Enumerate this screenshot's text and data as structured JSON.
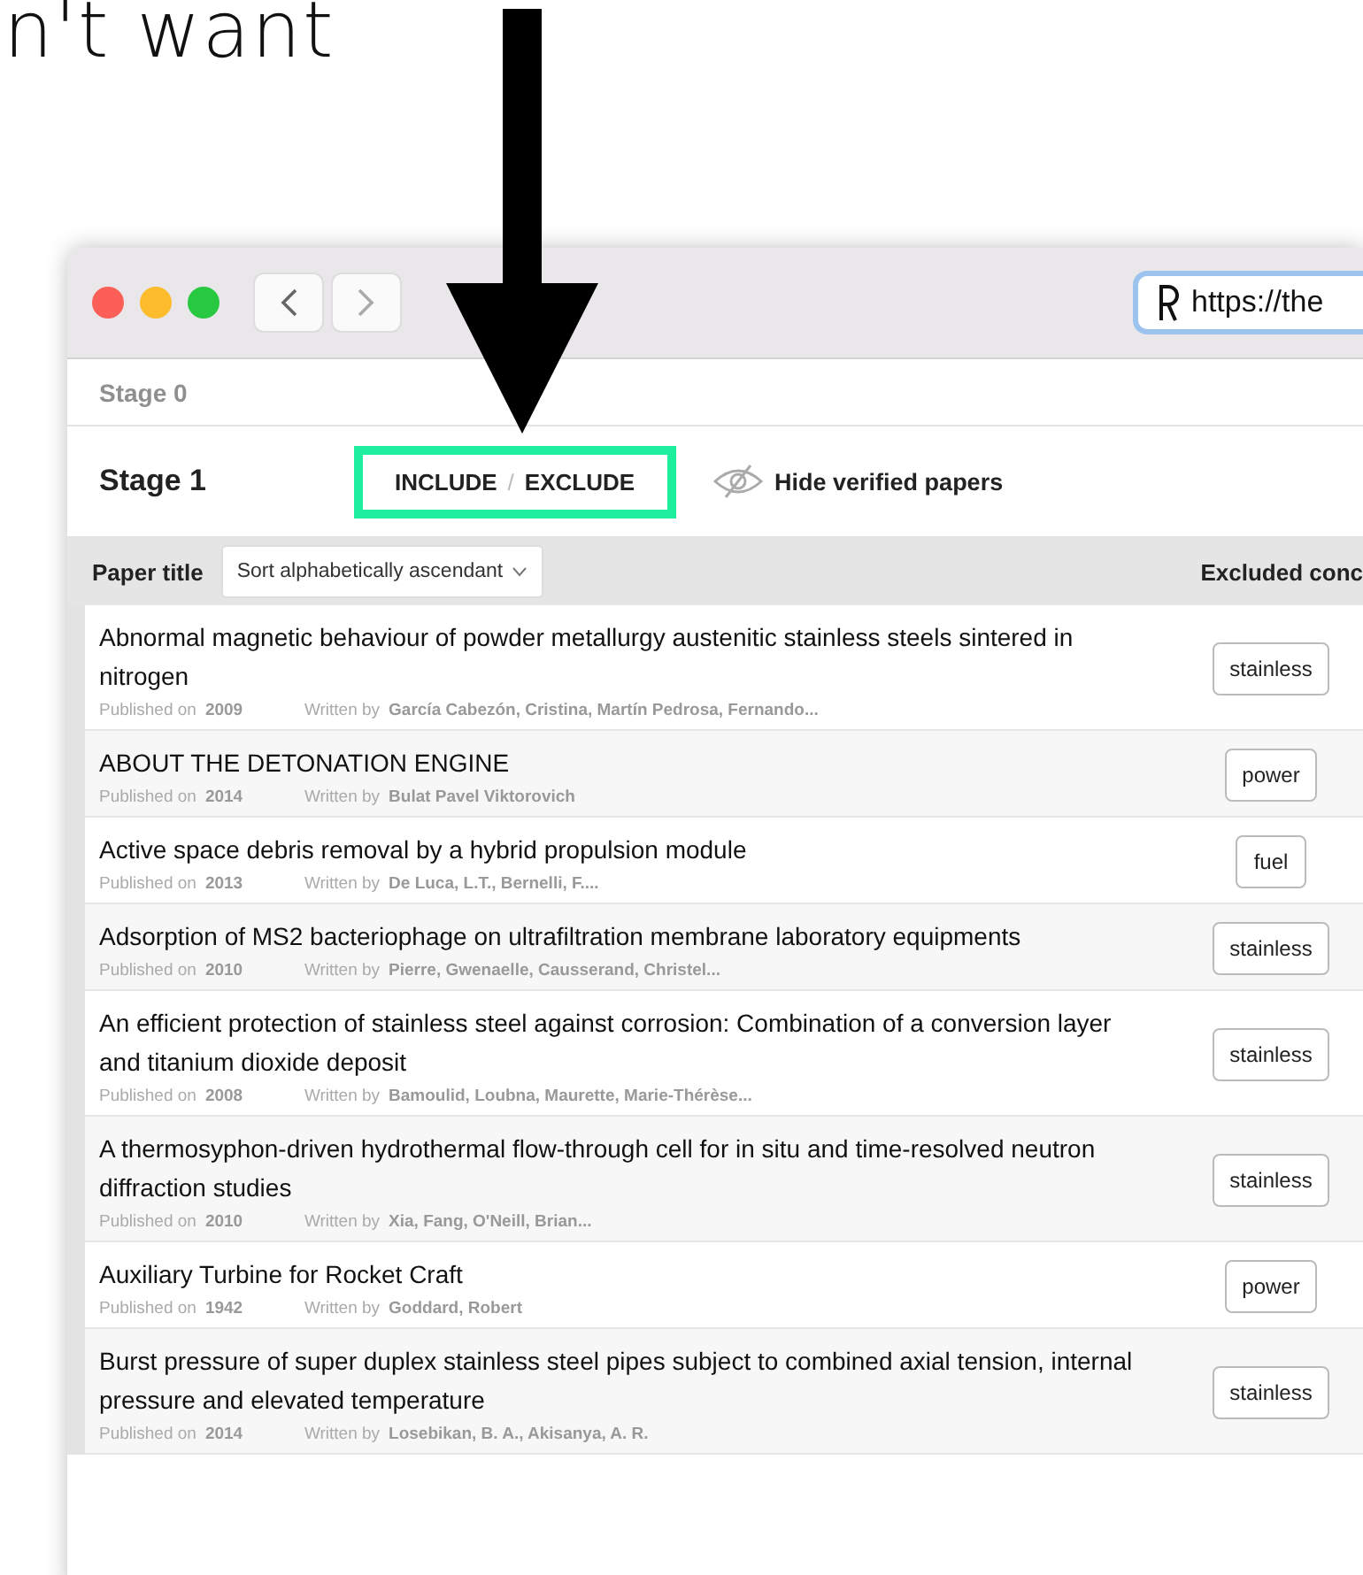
{
  "slide_text": "n't want",
  "browser": {
    "url": "https://the"
  },
  "stages": [
    {
      "label": "Stage 0",
      "disabled": true
    },
    {
      "label": "Stage 1",
      "disabled": false
    }
  ],
  "toggle": {
    "include": "INCLUDE",
    "separator": "/",
    "exclude": "EXCLUDE",
    "highlighted": true
  },
  "hide_verified": {
    "label": "Hide verified papers"
  },
  "header": {
    "title": "Paper title",
    "sort": "Sort alphabetically ascendant",
    "excluded": "Excluded conc"
  },
  "papers": [
    {
      "title": "Abnormal magnetic behaviour of powder metallurgy austenitic stainless steels sintered in nitrogen",
      "published_label": "Published on",
      "year": "2009",
      "written_label": "Written by",
      "authors": "García Cabezón, Cristina, Martín Pedrosa, Fernando...",
      "concept": "stainless"
    },
    {
      "title": "ABOUT THE DETONATION ENGINE",
      "published_label": "Published on",
      "year": "2014",
      "written_label": "Written by",
      "authors": "Bulat Pavel Viktorovich",
      "concept": "power"
    },
    {
      "title": "Active space debris removal by a hybrid propulsion module",
      "published_label": "Published on",
      "year": "2013",
      "written_label": "Written by",
      "authors": "De Luca, L.T., Bernelli, F....",
      "concept": "fuel"
    },
    {
      "title": "Adsorption of MS2 bacteriophage on ultrafiltration membrane laboratory equipments",
      "published_label": "Published on",
      "year": "2010",
      "written_label": "Written by",
      "authors": "Pierre, Gwenaelle, Causserand, Christel...",
      "concept": "stainless"
    },
    {
      "title": "An efficient protection of stainless steel against corrosion: Combination of a conversion layer and titanium dioxide deposit",
      "published_label": "Published on",
      "year": "2008",
      "written_label": "Written by",
      "authors": "Bamoulid, Loubna, Maurette, Marie-Thérèse...",
      "concept": "stainless"
    },
    {
      "title": "A thermosyphon-driven hydrothermal flow-through cell for in situ and time-resolved neutron diffraction studies",
      "published_label": "Published on",
      "year": "2010",
      "written_label": "Written by",
      "authors": "Xia, Fang, O'Neill, Brian...",
      "concept": "stainless"
    },
    {
      "title": "Auxiliary Turbine for Rocket Craft",
      "published_label": "Published on",
      "year": "1942",
      "written_label": "Written by",
      "authors": "Goddard, Robert",
      "concept": "power"
    },
    {
      "title": "Burst pressure of super duplex stainless steel pipes subject to combined axial tension, internal pressure and elevated temperature",
      "published_label": "Published on",
      "year": "2014",
      "written_label": "Written by",
      "authors": "Losebikan, B. A., Akisanya, A. R.",
      "concept": "stainless"
    }
  ]
}
